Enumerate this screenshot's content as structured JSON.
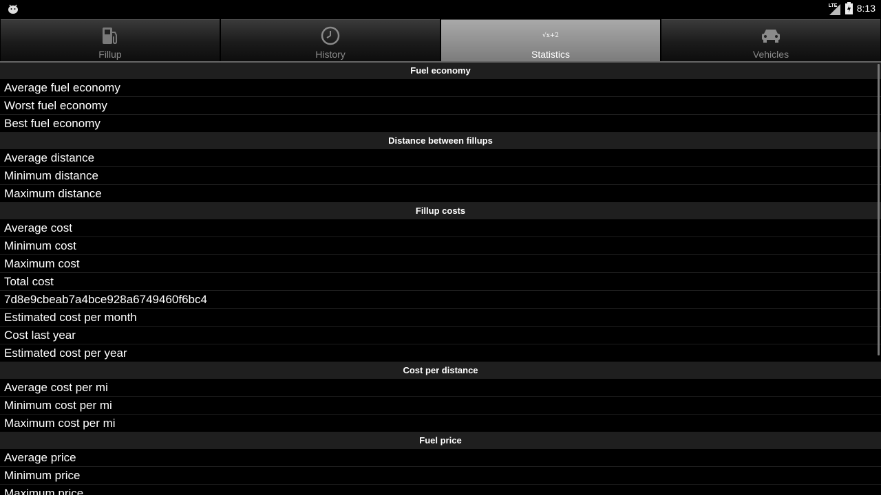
{
  "status_bar": {
    "network": "LTE",
    "battery_level": 0.9,
    "time": "8:13"
  },
  "tabs": [
    {
      "label": "Fillup",
      "icon": "fuel-pump-icon",
      "selected": false
    },
    {
      "label": "History",
      "icon": "clock-icon",
      "selected": false
    },
    {
      "label": "Statistics",
      "icon": "formula-icon",
      "icon_text": "√x+2",
      "selected": true
    },
    {
      "label": "Vehicles",
      "icon": "car-icon",
      "selected": false
    }
  ],
  "sections": [
    {
      "title": "Fuel economy",
      "rows": [
        "Average fuel economy",
        "Worst fuel economy",
        "Best fuel economy"
      ]
    },
    {
      "title": "Distance between fillups",
      "rows": [
        "Average distance",
        "Minimum distance",
        "Maximum distance"
      ]
    },
    {
      "title": "Fillup costs",
      "rows": [
        "Average cost",
        "Minimum cost",
        "Maximum cost",
        "Total cost",
        "7d8e9cbeab7a4bce928a6749460f6bc4",
        "Estimated cost per month",
        "Cost last year",
        "Estimated cost per year"
      ]
    },
    {
      "title": "Cost per distance",
      "rows": [
        "Average cost per mi",
        "Minimum cost per mi",
        "Maximum cost per mi"
      ]
    },
    {
      "title": "Fuel price",
      "rows": [
        "Average price",
        "Minimum price",
        "Maximum price"
      ]
    }
  ],
  "colors": {
    "background": "#000000",
    "section_header": "#1f1f1f",
    "tab_selected": "#9a9a9a",
    "tab_label_inactive": "#8a8a8a"
  }
}
